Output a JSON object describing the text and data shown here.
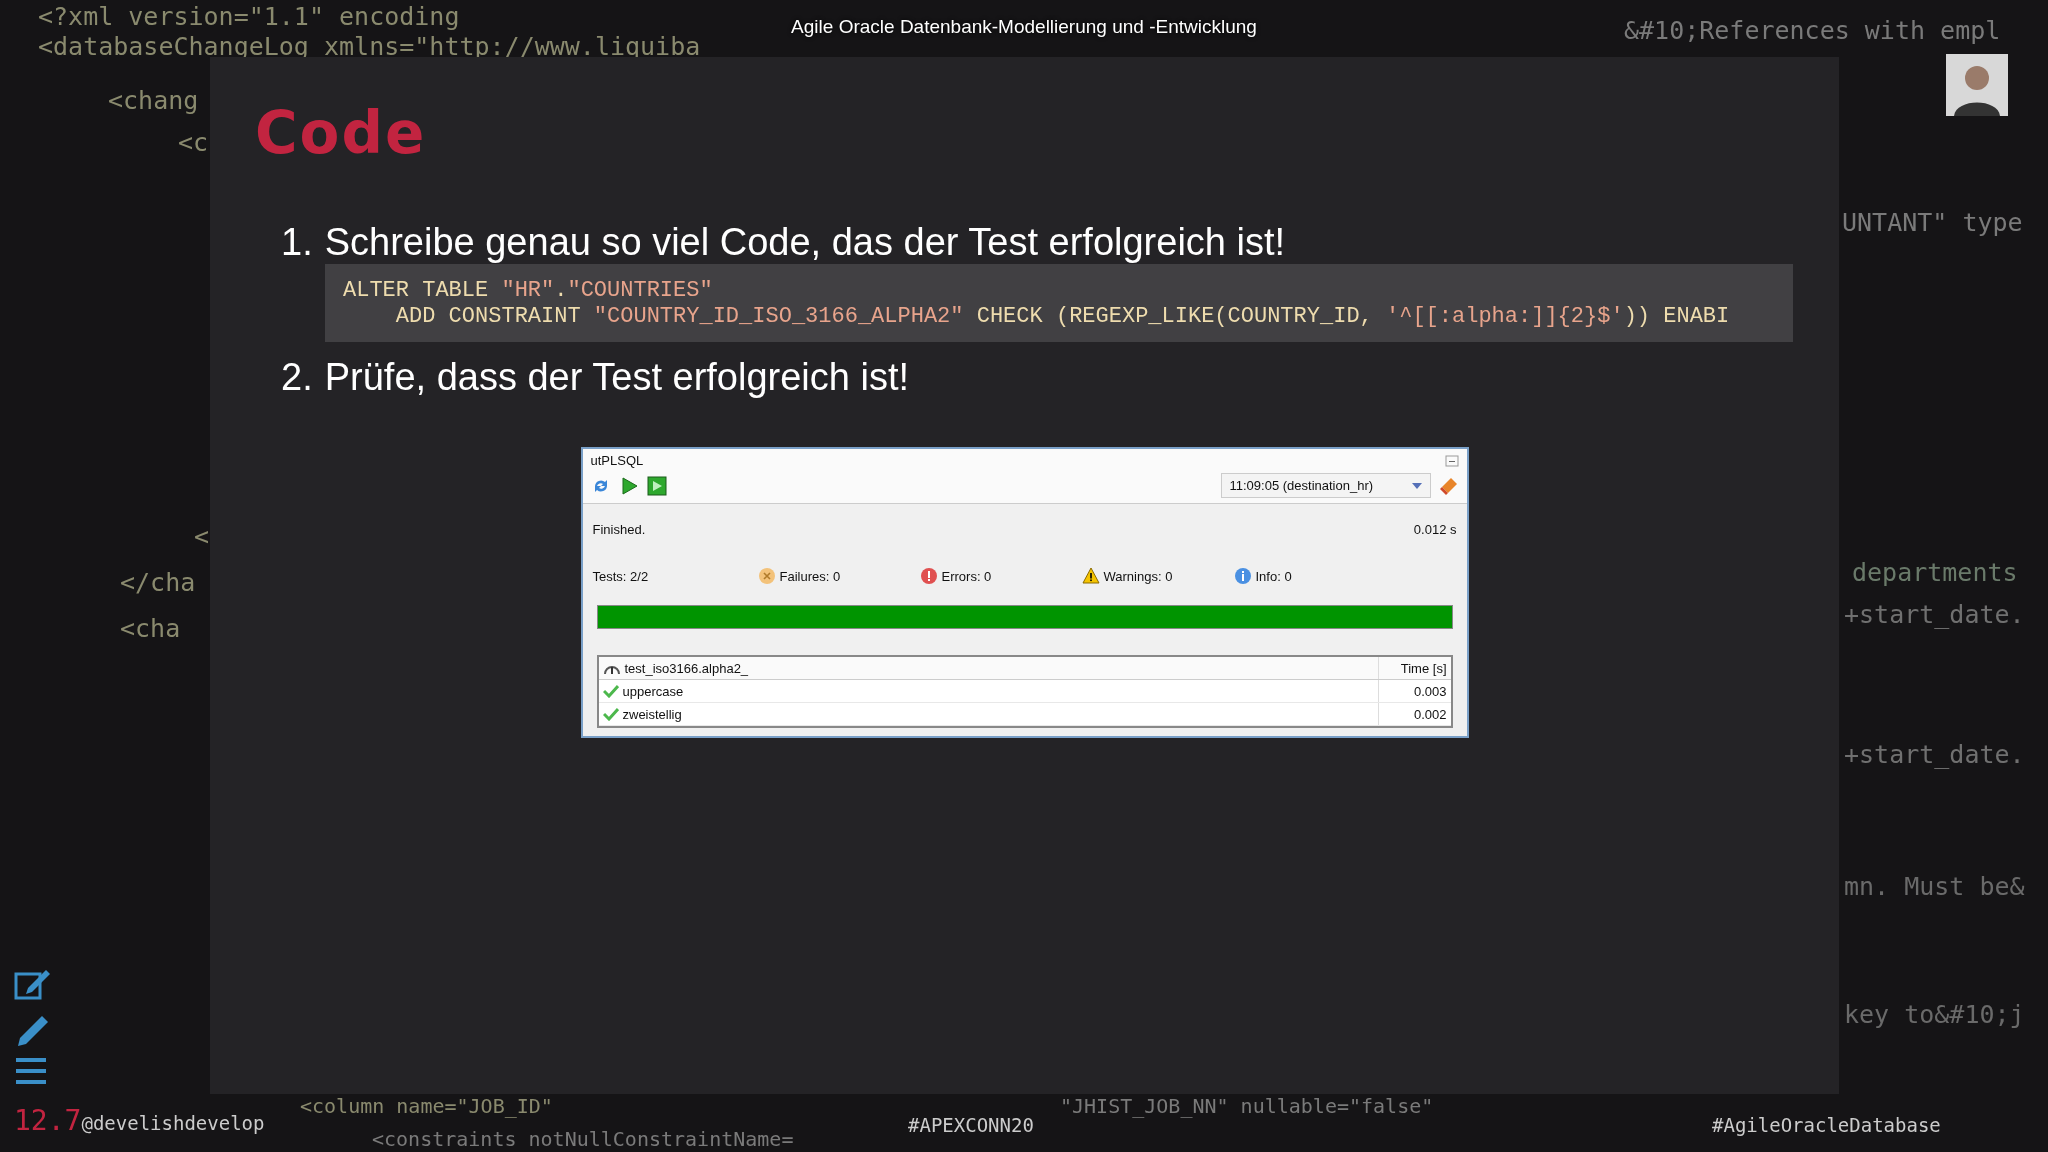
{
  "header": {
    "title": "Agile Oracle Datenbank-Modellierung und -Entwicklung"
  },
  "background_code": [
    "<?xml version=\"1.1\" encoding",
    "<databaseChangeLog xmlns=\"http://www.liquiba",
    "<chang",
    "<c",
    "<",
    "</cha",
    "<cha",
    "&#10;References with empl",
    "UNTANT\" type",
    "departments",
    "+start_date.",
    "+start_date.",
    "mn. Must be&",
    "key to&#10;j",
    "<column name=\"JOB_ID\"",
    "\"JHIST_JOB_NN\" nullable=\"false\"",
    "<constraints notNullConstraintName="
  ],
  "slide": {
    "heading": "Code",
    "steps": [
      {
        "number": "1.",
        "text": "Schreibe genau so viel Code, das der Test erfolgreich ist!"
      },
      {
        "number": "2.",
        "text": "Prüfe, dass der Test erfolgreich ist!"
      }
    ],
    "code": [
      [
        {
          "kind": "keyword",
          "text": "ALTER TABLE "
        },
        {
          "kind": "string",
          "text": "\"HR\""
        },
        {
          "kind": "keyword",
          "text": "."
        },
        {
          "kind": "string",
          "text": "\"COUNTRIES\""
        }
      ],
      [
        {
          "kind": "keyword",
          "text": "    ADD CONSTRAINT "
        },
        {
          "kind": "string",
          "text": "\"COUNTRY_ID_ISO_3166_ALPHA2\""
        },
        {
          "kind": "keyword",
          "text": " CHECK (REGEXP_LIKE(COUNTRY_ID, "
        },
        {
          "kind": "string",
          "text": "'^[[:alpha:]]{2}$'"
        },
        {
          "kind": "keyword",
          "text": ")) ENABI"
        }
      ]
    ],
    "test_window": {
      "title": "utPLSQL",
      "run_selector": "11:09:05 (destination_hr)",
      "status": "Finished.",
      "duration": "0.012 s",
      "counters": [
        {
          "kind": "tests",
          "label": "Tests:  2/2"
        },
        {
          "kind": "failures",
          "label": "Failures:  0"
        },
        {
          "kind": "errors",
          "label": "Errors:  0"
        },
        {
          "kind": "warnings",
          "label": "Warnings:  0"
        },
        {
          "kind": "info",
          "label": "Info:  0"
        }
      ],
      "progress": {
        "level": 1
      },
      "table": {
        "suite": "test_iso3166.alpha2_",
        "time_header": "Time [s]",
        "rows": [
          {
            "name": "uppercase",
            "time": "0.003",
            "passed": true
          },
          {
            "name": "zweistellig",
            "time": "0.002",
            "passed": true
          }
        ]
      }
    }
  },
  "footer": {
    "slide_number": "12.7",
    "handle": "@develishdevelop",
    "hashtag_event": "#APEXCONN20",
    "hashtag_topic": "#AgileOracleDatabase"
  }
}
